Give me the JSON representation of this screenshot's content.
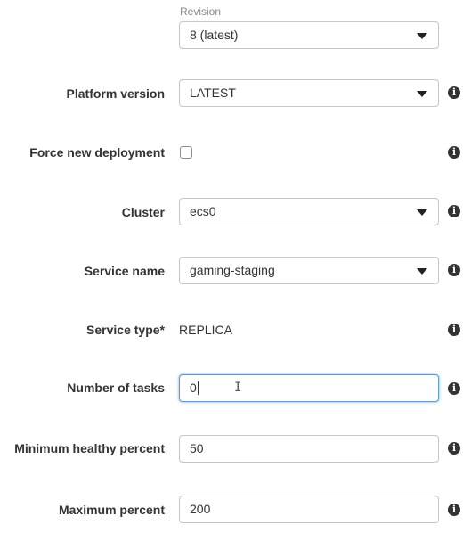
{
  "revision": {
    "caption": "Revision",
    "value": "8 (latest)"
  },
  "fields": {
    "platform_version": {
      "label": "Platform version",
      "value": "LATEST",
      "info_icon": "info-icon"
    },
    "force_new_deployment": {
      "label": "Force new deployment",
      "checked": false,
      "info_icon": "info-icon"
    },
    "cluster": {
      "label": "Cluster",
      "value": "ecs0",
      "info_icon": "info-icon"
    },
    "service_name": {
      "label": "Service name",
      "value": "gaming-staging",
      "info_icon": "info-icon"
    },
    "service_type": {
      "label": "Service type*",
      "value": "REPLICA",
      "info_icon": "info-icon"
    },
    "number_of_tasks": {
      "label": "Number of tasks",
      "value": "0",
      "info_icon": "info-icon"
    },
    "minimum_healthy_percent": {
      "label": "Minimum healthy percent",
      "value": "50",
      "info_icon": "info-icon"
    },
    "maximum_percent": {
      "label": "Maximum percent",
      "value": "200",
      "info_icon": "info-icon"
    }
  },
  "icons": {
    "info_glyph": "i",
    "dropdown": "chevron-down-icon",
    "text_cursor": "I"
  },
  "colors": {
    "focus_border": "#5b9bd5",
    "label_text": "#333333",
    "caption_text": "#888888"
  }
}
